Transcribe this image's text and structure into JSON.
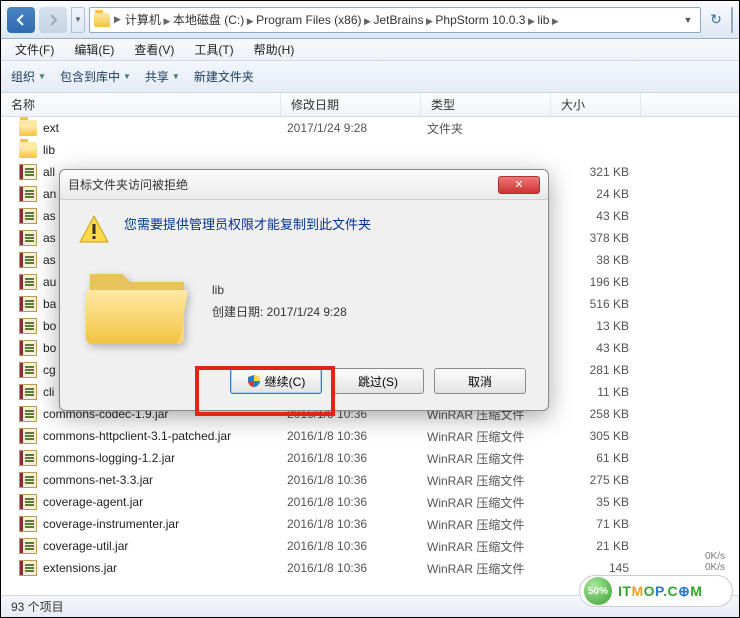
{
  "breadcrumbs": [
    "计算机",
    "本地磁盘 (C:)",
    "Program Files (x86)",
    "JetBrains",
    "PhpStorm 10.0.3",
    "lib"
  ],
  "menus": {
    "file": "文件(F)",
    "edit": "编辑(E)",
    "view": "查看(V)",
    "tools": "工具(T)",
    "help": "帮助(H)"
  },
  "toolbar": {
    "organize": "组织",
    "include": "包含到库中",
    "share": "共享",
    "newfolder": "新建文件夹"
  },
  "columns": {
    "name": "名称",
    "date": "修改日期",
    "type": "类型",
    "size": "大小"
  },
  "status": {
    "count": "93 个项目"
  },
  "dialog": {
    "title": "目标文件夹访问被拒绝",
    "message": "您需要提供管理员权限才能复制到此文件夹",
    "folder_name": "lib",
    "created_label": "创建日期: 2017/1/24 9:28",
    "continue": "继续(C)",
    "skip": "跳过(S)",
    "cancel": "取消"
  },
  "watermark": {
    "percent": "50%",
    "speed_up": "0K/s",
    "speed_dn": "0K/s"
  },
  "files": [
    {
      "name": "ext",
      "date": "2017/1/24 9:28",
      "type": "文件夹",
      "size": "",
      "kind": "folder"
    },
    {
      "name": "lib",
      "date": "",
      "type": "",
      "size": "",
      "kind": "folder"
    },
    {
      "name": "all",
      "date": "",
      "type": "",
      "size": "321 KB",
      "kind": "rar"
    },
    {
      "name": "an",
      "date": "",
      "type": "",
      "size": "24 KB",
      "kind": "rar"
    },
    {
      "name": "as",
      "date": "",
      "type": "",
      "size": "43 KB",
      "kind": "rar"
    },
    {
      "name": "as",
      "date": "",
      "type": "",
      "size": "378 KB",
      "kind": "rar"
    },
    {
      "name": "as",
      "date": "",
      "type": "",
      "size": "38 KB",
      "kind": "rar"
    },
    {
      "name": "au",
      "date": "",
      "type": "",
      "size": "196 KB",
      "kind": "rar"
    },
    {
      "name": "ba",
      "date": "",
      "type": "",
      "size": "516 KB",
      "kind": "rar"
    },
    {
      "name": "bo",
      "date": "",
      "type": "",
      "size": "13 KB",
      "kind": "rar"
    },
    {
      "name": "bo",
      "date": "",
      "type": "",
      "size": "43 KB",
      "kind": "rar"
    },
    {
      "name": "cg",
      "date": "",
      "type": "",
      "size": "281 KB",
      "kind": "rar"
    },
    {
      "name": "cli",
      "date": "",
      "type": "",
      "size": "11 KB",
      "kind": "rar"
    },
    {
      "name": "commons-codec-1.9.jar",
      "date": "2016/1/8 10:36",
      "type": "WinRAR 压缩文件",
      "size": "258 KB",
      "kind": "rar"
    },
    {
      "name": "commons-httpclient-3.1-patched.jar",
      "date": "2016/1/8 10:36",
      "type": "WinRAR 压缩文件",
      "size": "305 KB",
      "kind": "rar"
    },
    {
      "name": "commons-logging-1.2.jar",
      "date": "2016/1/8 10:36",
      "type": "WinRAR 压缩文件",
      "size": "61 KB",
      "kind": "rar"
    },
    {
      "name": "commons-net-3.3.jar",
      "date": "2016/1/8 10:36",
      "type": "WinRAR 压缩文件",
      "size": "275 KB",
      "kind": "rar"
    },
    {
      "name": "coverage-agent.jar",
      "date": "2016/1/8 10:36",
      "type": "WinRAR 压缩文件",
      "size": "35 KB",
      "kind": "rar"
    },
    {
      "name": "coverage-instrumenter.jar",
      "date": "2016/1/8 10:36",
      "type": "WinRAR 压缩文件",
      "size": "71 KB",
      "kind": "rar"
    },
    {
      "name": "coverage-util.jar",
      "date": "2016/1/8 10:36",
      "type": "WinRAR 压缩文件",
      "size": "21 KB",
      "kind": "rar"
    },
    {
      "name": "extensions.jar",
      "date": "2016/1/8 10:36",
      "type": "WinRAR 压缩文件",
      "size": "145",
      "kind": "rar"
    }
  ]
}
